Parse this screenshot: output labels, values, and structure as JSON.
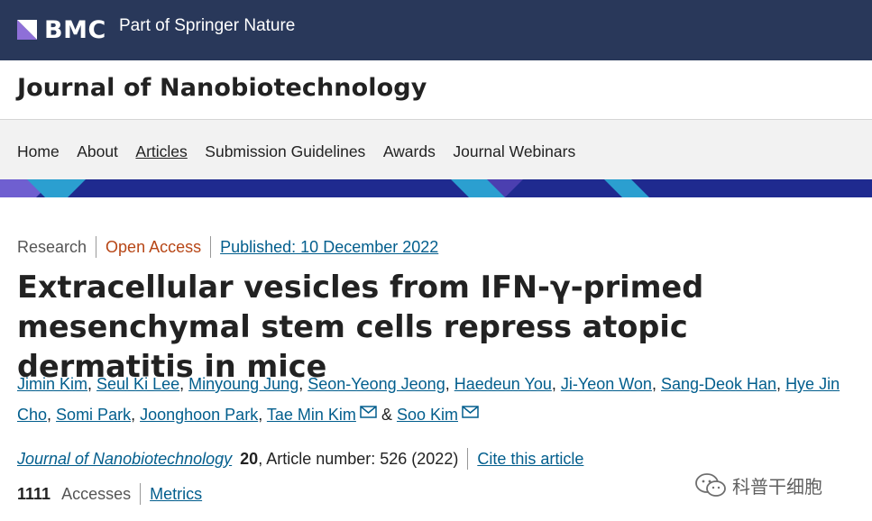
{
  "brand": {
    "logo_text": "BMC",
    "tagline": "Part of Springer Nature"
  },
  "journal": {
    "title": "Journal of Nanobiotechnology"
  },
  "nav": {
    "items": [
      {
        "label": "Home",
        "active": false
      },
      {
        "label": "About",
        "active": false
      },
      {
        "label": "Articles",
        "active": true
      },
      {
        "label": "Submission Guidelines",
        "active": false
      },
      {
        "label": "Awards",
        "active": false
      },
      {
        "label": "Journal Webinars",
        "active": false
      }
    ]
  },
  "article": {
    "type": "Research",
    "access": "Open Access",
    "published": "Published: 10 December 2022",
    "title": "Extracellular vesicles from IFN-γ-primed mesenchymal stem cells repress atopic dermatitis in mice",
    "authors": {
      "list": [
        "Jimin Kim",
        "Seul Ki Lee",
        "Minyoung Jung",
        "Seon-Yeong Jeong",
        "Haedeun You",
        "Ji-Yeon Won",
        "Sang-Deok Han",
        "Hye Jin Cho",
        "Somi Park",
        "Joonghoon Park",
        "Tae Min Kim",
        "Soo Kim"
      ],
      "conjunction": "&"
    },
    "citation": {
      "journal": "Journal of Nanobiotechnology",
      "volume": "20",
      "article_number": ", Article number: 526 (2022)",
      "cite_label": "Cite this article"
    },
    "metrics": {
      "accesses_count": "1111",
      "accesses_label": "Accesses",
      "metrics_label": "Metrics"
    }
  },
  "watermark": {
    "text": "科普干细胞",
    "icon": "wechat-icon"
  },
  "colors": {
    "brand_bar": "#29385a",
    "link": "#025e8d",
    "open_access": "#b74616",
    "nav_bg": "#f2f2f2",
    "stripe_dark": "#1f2a8f",
    "stripe_light": "#2b9fd0"
  }
}
